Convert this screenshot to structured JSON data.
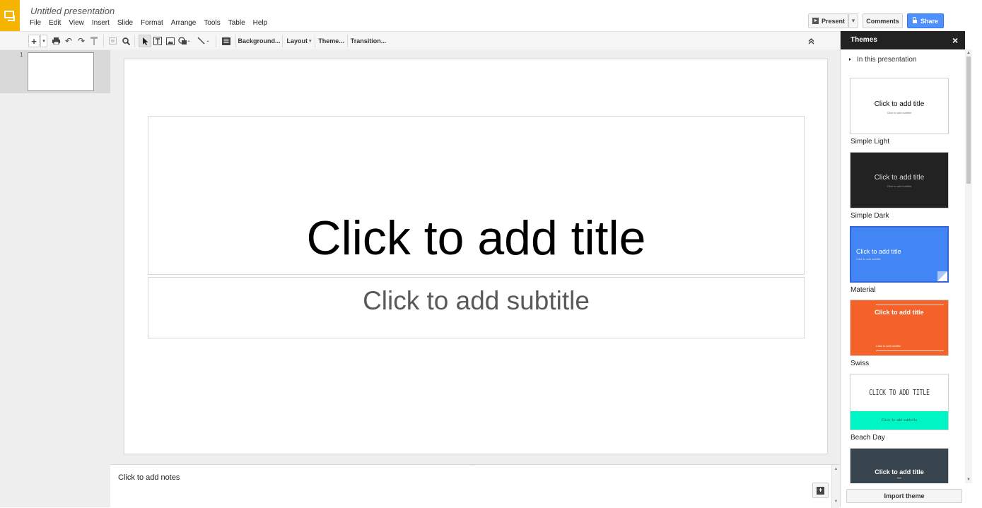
{
  "app": {
    "doc_title": "Untitled presentation"
  },
  "menubar": {
    "items": [
      "File",
      "Edit",
      "View",
      "Insert",
      "Slide",
      "Format",
      "Arrange",
      "Tools",
      "Table",
      "Help"
    ]
  },
  "header": {
    "present_label": "Present",
    "comments_label": "Comments",
    "share_label": "Share"
  },
  "toolbar": {
    "background_label": "Background...",
    "layout_label": "Layout",
    "theme_label": "Theme...",
    "transition_label": "Transition..."
  },
  "filmstrip": {
    "slide_number": "1"
  },
  "slide": {
    "title_placeholder": "Click to add title",
    "subtitle_placeholder": "Click to add subtitle"
  },
  "notes": {
    "placeholder": "Click to add notes"
  },
  "themes_panel": {
    "title": "Themes",
    "close_label": "×",
    "section_label": "In this presentation",
    "import_label": "Import theme",
    "preview_title": "Click to add title",
    "preview_subtitle": "Click to add subtitle",
    "themes": [
      {
        "name": "Simple Light",
        "bg": "#ffffff"
      },
      {
        "name": "Simple Dark",
        "bg": "#222222"
      },
      {
        "name": "Material",
        "bg": "#4285f4"
      },
      {
        "name": "Swiss",
        "bg": "#f4622a"
      },
      {
        "name": "Beach Day",
        "bg": "#00f5c4"
      },
      {
        "name": "",
        "bg": "#38454f"
      }
    ]
  },
  "colors": {
    "logo": "#f4b400",
    "share": "#4d90fe",
    "panel_header": "#222222"
  }
}
